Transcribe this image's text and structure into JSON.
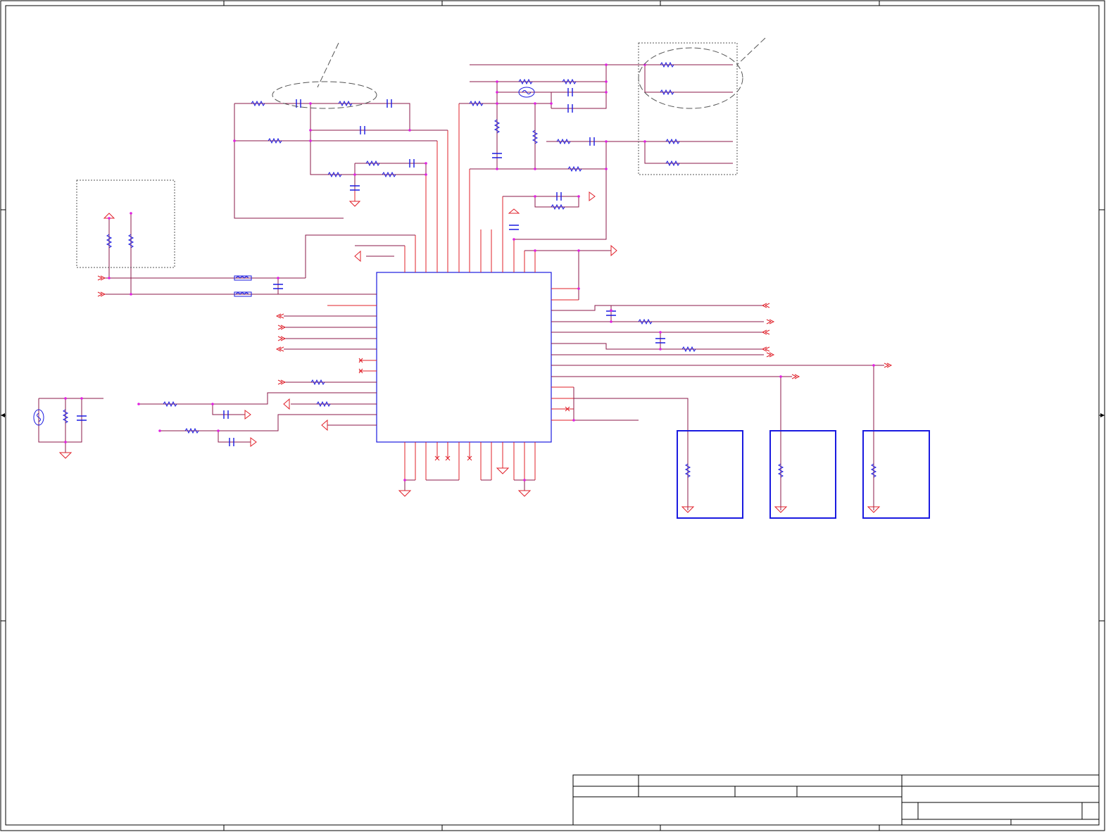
{
  "sheet": {
    "title_block": {
      "title": "",
      "size": "",
      "document_number": "",
      "rev": "",
      "date": "",
      "sheet": ""
    }
  },
  "colors": {
    "wire": "#8b1a4a",
    "pin": "#e0202a",
    "component": "#1a1ae0",
    "junction": "#e020e0",
    "frame": "#000000",
    "annotation": "#555555"
  },
  "icons": [
    "resistor-icon",
    "capacitor-icon",
    "inductor-icon",
    "crystal-icon",
    "ground-icon",
    "power-arrow-icon",
    "offpage-connector-icon",
    "no-connect-icon"
  ]
}
